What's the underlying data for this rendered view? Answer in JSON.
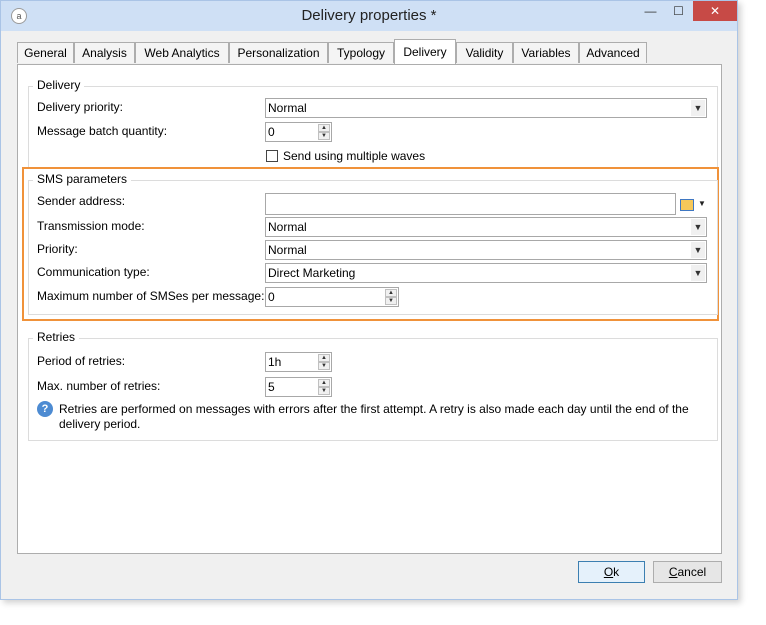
{
  "window": {
    "title": "Delivery properties *",
    "icon": "app-logo-icon"
  },
  "titlebar_buttons": {
    "minimize": "—",
    "maximize": "☐",
    "close": "✕"
  },
  "tabs": [
    {
      "label": "General"
    },
    {
      "label": "Analysis"
    },
    {
      "label": "Web Analytics"
    },
    {
      "label": "Personalization"
    },
    {
      "label": "Typology"
    },
    {
      "label": "Delivery",
      "active": true
    },
    {
      "label": "Validity"
    },
    {
      "label": "Variables"
    },
    {
      "label": "Advanced"
    }
  ],
  "delivery": {
    "legend": "Delivery",
    "priority_label": "Delivery priority:",
    "priority_value": "Normal",
    "batch_label": "Message batch quantity:",
    "batch_value": "0",
    "waves_label": "Send using multiple waves",
    "waves_checked": false
  },
  "sms": {
    "legend": "SMS parameters",
    "sender_label": "Sender address:",
    "sender_value": "",
    "transmission_label": "Transmission mode:",
    "transmission_value": "Normal",
    "priority_label": "Priority:",
    "priority_value": "Normal",
    "comm_label": "Communication type:",
    "comm_value": "Direct Marketing",
    "max_label": "Maximum number of SMSes per message:",
    "max_value": "0",
    "highlight_color": "#f0923a"
  },
  "retries": {
    "legend": "Retries",
    "period_label": "Period of retries:",
    "period_value": "1h",
    "max_label": "Max. number of retries:",
    "max_value": "5",
    "info_line1": "Retries are performed on messages with errors after the first attempt. A retry is also made each day until the end of the",
    "info_line2": "delivery period."
  },
  "buttons": {
    "ok": "Ok",
    "cancel": "Cancel"
  }
}
